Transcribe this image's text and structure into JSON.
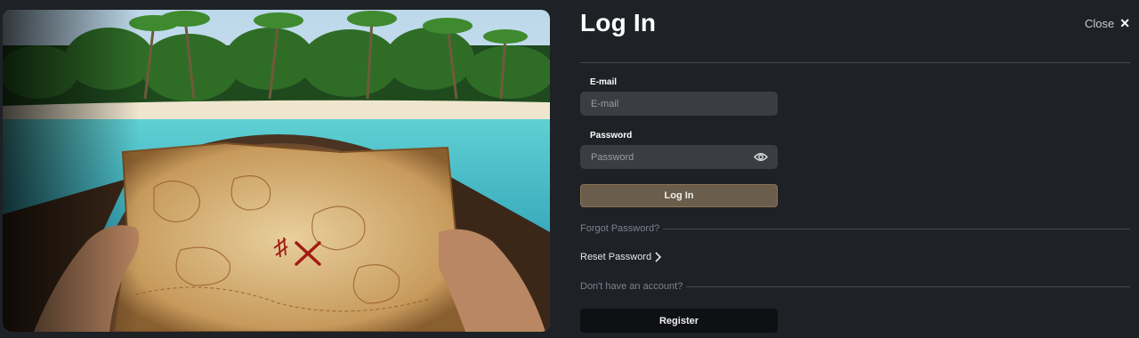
{
  "hero": {
    "image": "treasure-map-boat-island-photo"
  },
  "header": {
    "title": "Log In",
    "close_label": "Close",
    "close_icon": "close-icon"
  },
  "form": {
    "email_label": "E-mail",
    "email_placeholder": "E-mail",
    "password_label": "Password",
    "password_placeholder": "Password",
    "password_toggle_icon": "eye-icon",
    "submit_label": "Log In"
  },
  "links": {
    "forgot_password": "Forgot Password?",
    "reset_password": "Reset Password",
    "reset_icon": "chevron-right-icon",
    "no_account": "Don't have an account?"
  },
  "register": {
    "label": "Register"
  },
  "colors": {
    "background": "#1e2126",
    "field": "#3a3d43",
    "accent_button": "#6b5d4b",
    "register_button": "#0f1013",
    "muted_link": "#7d8290"
  }
}
